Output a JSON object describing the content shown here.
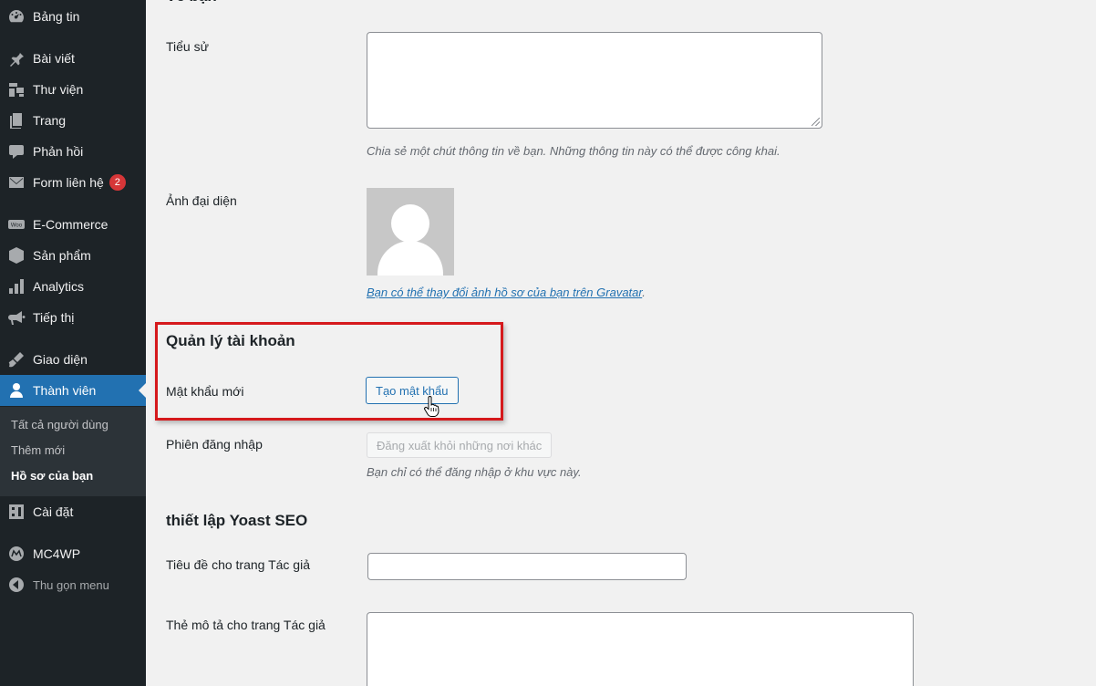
{
  "sidebar": {
    "items": [
      {
        "label": "Bảng tin",
        "icon": "dashboard-icon"
      },
      {
        "label": "Bài viết",
        "icon": "pin-icon"
      },
      {
        "label": "Thư viện",
        "icon": "media-icon"
      },
      {
        "label": "Trang",
        "icon": "pages-icon"
      },
      {
        "label": "Phản hồi",
        "icon": "comments-icon"
      },
      {
        "label": "Form liên hệ",
        "icon": "mail-icon",
        "badge": "2"
      },
      {
        "label": "E-Commerce",
        "icon": "woo-icon"
      },
      {
        "label": "Sản phẩm",
        "icon": "products-icon"
      },
      {
        "label": "Analytics",
        "icon": "analytics-icon"
      },
      {
        "label": "Tiếp thị",
        "icon": "megaphone-icon"
      },
      {
        "label": "Giao diện",
        "icon": "appearance-icon"
      },
      {
        "label": "Thành viên",
        "icon": "users-icon",
        "active": true
      },
      {
        "label": "Cài đặt",
        "icon": "settings-icon"
      },
      {
        "label": "MC4WP",
        "icon": "mc4wp-icon"
      }
    ],
    "submenu": [
      {
        "label": "Tất cả người dùng"
      },
      {
        "label": "Thêm mới"
      },
      {
        "label": "Hồ sơ của bạn",
        "current": true
      }
    ],
    "collapse_label": "Thu gọn menu"
  },
  "profile": {
    "bio_label": "Tiểu sử",
    "bio_value": "",
    "bio_desc": "Chia sẻ một chút thông tin về bạn. Những thông tin này có thể được công khai.",
    "avatar_label": "Ảnh đại diện",
    "avatar_link": "Bạn có thể thay đổi ảnh hồ sơ của bạn trên Gravatar",
    "avatar_link_suffix": ".",
    "account_section_title": "Quản lý tài khoản",
    "new_password_label": "Mật khẩu mới",
    "generate_password_button": "Tạo mật khẩu",
    "sessions_label": "Phiên đăng nhập",
    "logout_everywhere_button": "Đăng xuất khỏi những nơi khác",
    "sessions_desc": "Bạn chỉ có thể đăng nhập ở khu vực này."
  },
  "yoast": {
    "section_title": "thiết lập Yoast SEO",
    "author_title_label": "Tiêu đề cho trang Tác giả",
    "author_title_value": "",
    "author_meta_label": "Thẻ mô tả cho trang Tác giả",
    "author_meta_value": ""
  },
  "colors": {
    "sidebar_bg": "#1d2327",
    "active_bg": "#2271b1",
    "highlight_border": "#d5191c",
    "badge": "#d63638"
  }
}
